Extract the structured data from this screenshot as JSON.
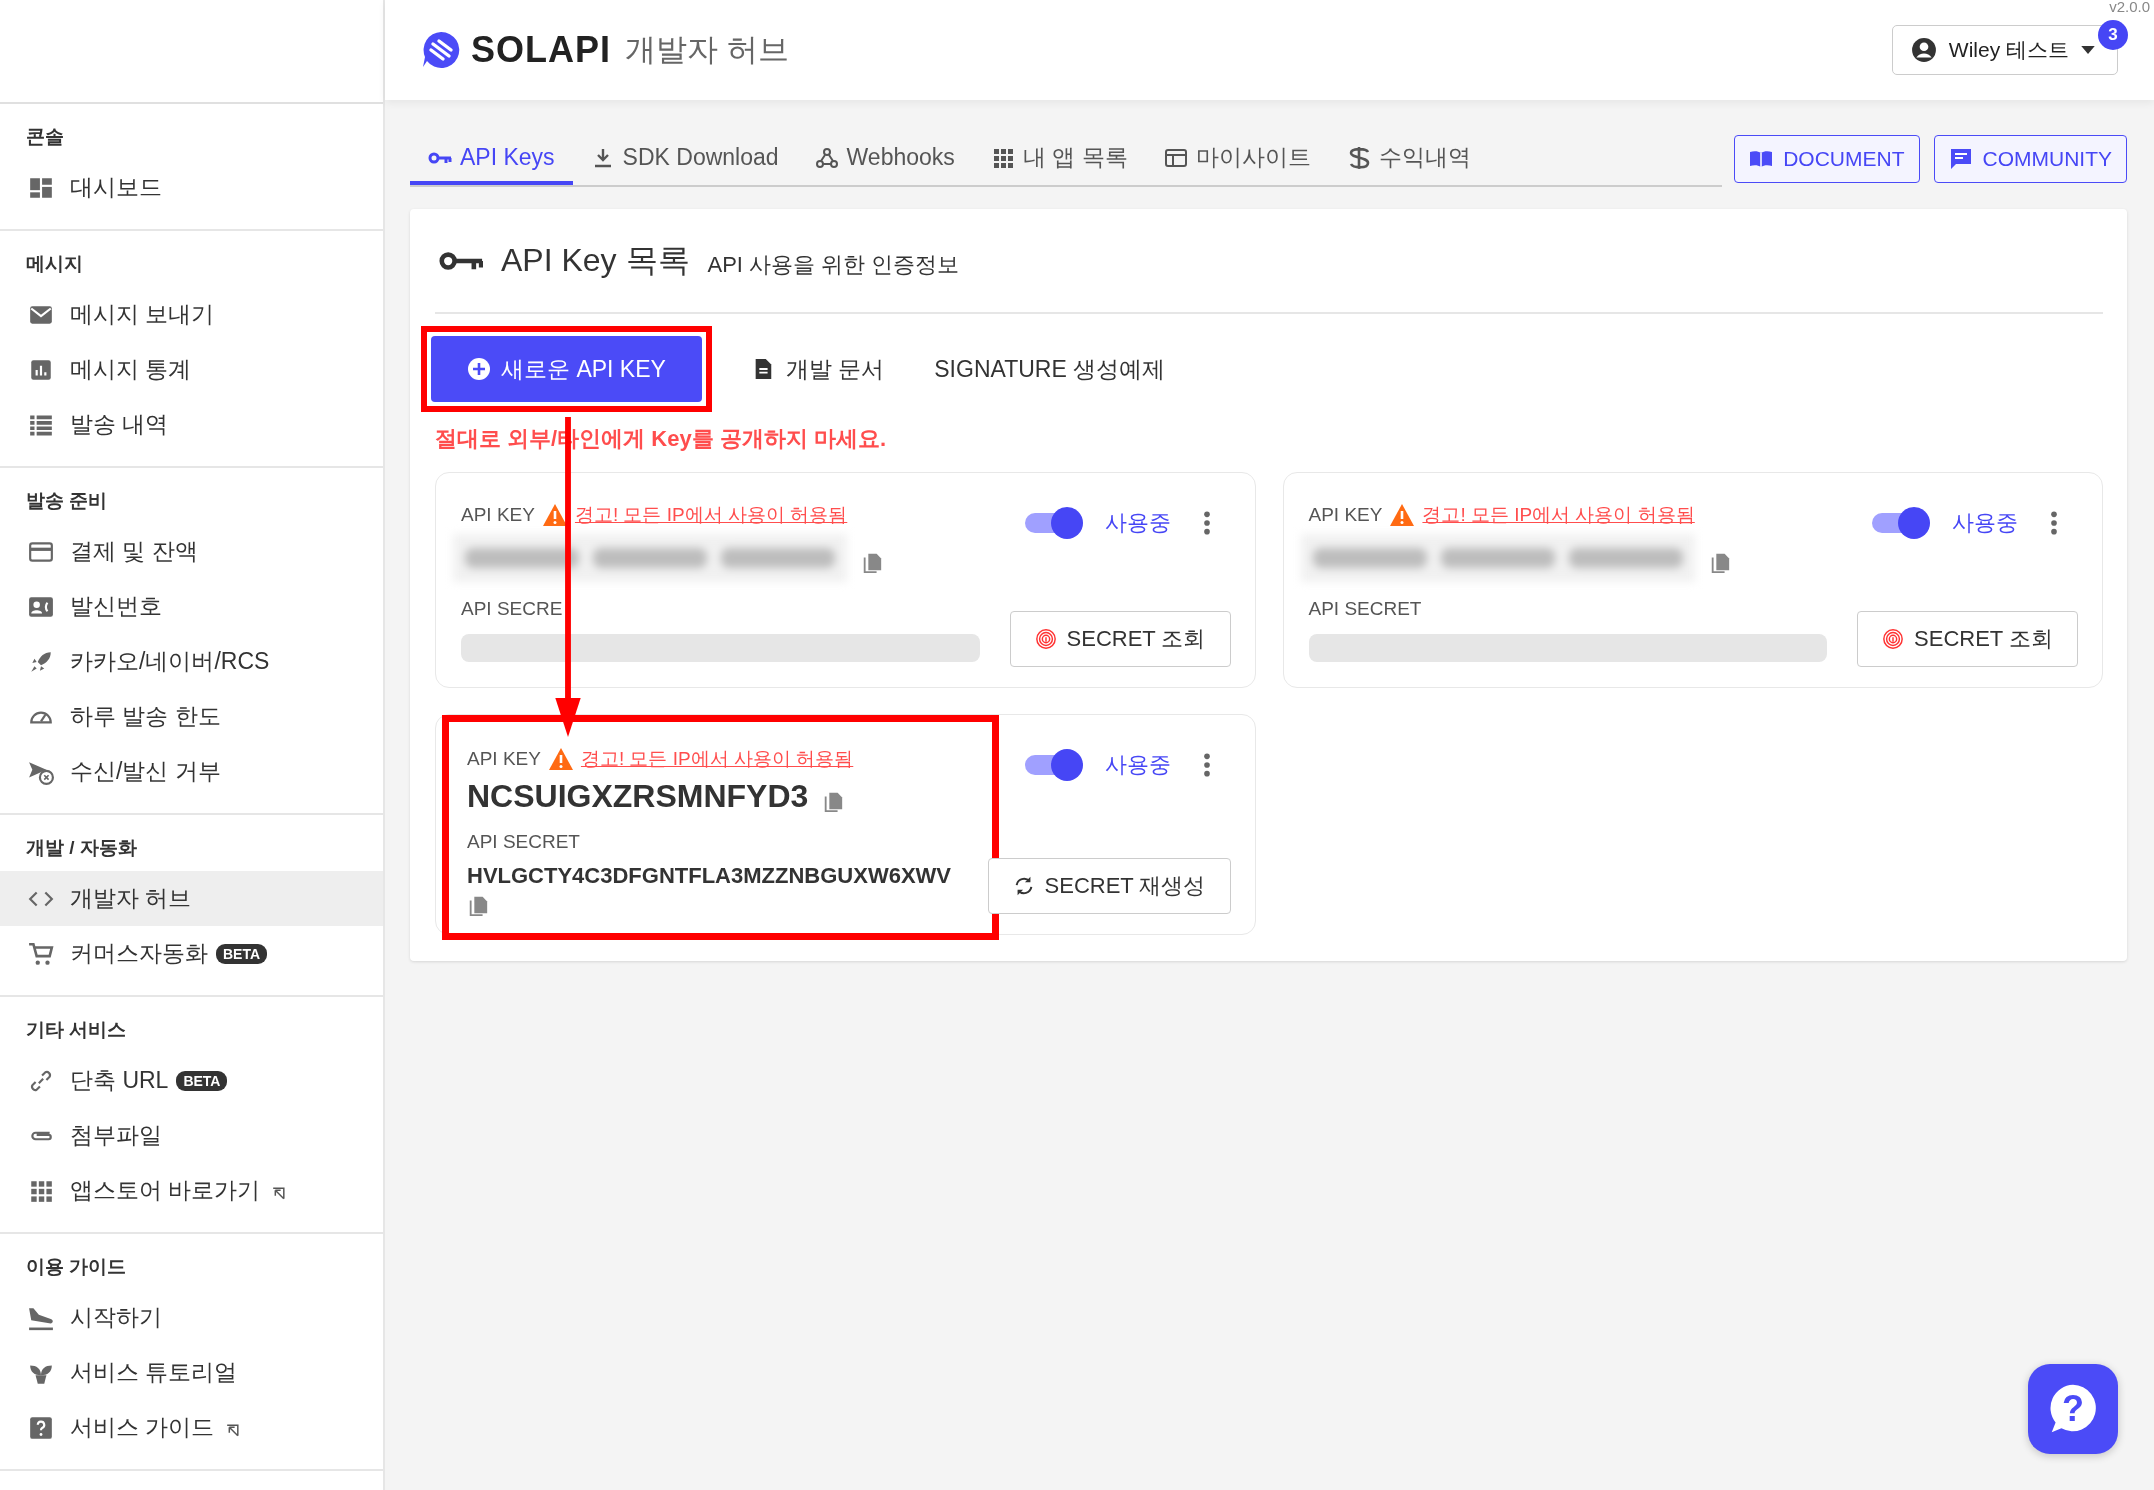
{
  "header": {
    "logo": "SOLAPI",
    "subtitle": "개발자 허브",
    "version": "v2.0.0",
    "user": "Wiley 테스트",
    "notification_count": "3"
  },
  "sidebar": {
    "sections": [
      {
        "title": "콘솔",
        "items": [
          {
            "label": "대시보드",
            "selected": false
          }
        ]
      },
      {
        "title": "메시지",
        "items": [
          {
            "label": "메시지 보내기",
            "selected": false
          },
          {
            "label": "메시지 통계",
            "selected": false
          },
          {
            "label": "발송 내역",
            "selected": false
          }
        ]
      },
      {
        "title": "발송 준비",
        "items": [
          {
            "label": "결제 및 잔액",
            "selected": false
          },
          {
            "label": "발신번호",
            "selected": false
          },
          {
            "label": "카카오/네이버/RCS",
            "selected": false
          },
          {
            "label": "하루 발송 한도",
            "selected": false
          },
          {
            "label": "수신/발신 거부",
            "selected": false
          }
        ]
      },
      {
        "title": "개발 / 자동화",
        "items": [
          {
            "label": "개발자 허브",
            "selected": true
          },
          {
            "label": "커머스자동화",
            "badge": "BETA",
            "selected": false
          }
        ]
      },
      {
        "title": "기타 서비스",
        "items": [
          {
            "label": "단축 URL",
            "badge": "BETA",
            "selected": false
          },
          {
            "label": "첨부파일",
            "selected": false
          },
          {
            "label": "앱스토어 바로가기",
            "external": true,
            "selected": false
          }
        ]
      },
      {
        "title": "이용 가이드",
        "items": [
          {
            "label": "시작하기",
            "selected": false
          },
          {
            "label": "서비스 튜토리얼",
            "selected": false
          },
          {
            "label": "서비스 가이드",
            "external": true,
            "selected": false
          }
        ]
      }
    ]
  },
  "tabs": [
    {
      "label": "API Keys",
      "selected": true
    },
    {
      "label": "SDK Download",
      "selected": false
    },
    {
      "label": "Webhooks",
      "selected": false
    },
    {
      "label": "내 앱 목록",
      "selected": false
    },
    {
      "label": "마이사이트",
      "selected": false
    },
    {
      "label": "수익내역",
      "selected": false
    }
  ],
  "links": [
    "DOCUMENT",
    "COMMUNITY"
  ],
  "panel": {
    "title": "API Key 목록",
    "subtitle": "API 사용을 위한 인증정보",
    "new_button": {
      "label": "새로운 API KEY",
      "highlighted": true
    },
    "actions": [
      "개발 문서",
      "SIGNATURE 생성예제"
    ],
    "warning": "절대로 외부/타인에게 Key를 공개하지 마세요."
  },
  "keys": [
    {
      "kind": "masked",
      "key_label": "API KEY",
      "ip_warning": "경고! 모든 IP에서 사용이 허용됨",
      "secret_label": "API SECRE",
      "on": true,
      "status": "사용중",
      "button": "SECRET 조회",
      "highlighted": false
    },
    {
      "kind": "masked",
      "key_label": "API KEY",
      "ip_warning": "경고! 모든 IP에서 사용이 허용됨",
      "secret_label": "API SECRET",
      "on": true,
      "status": "사용중",
      "button": "SECRET 조회",
      "highlighted": false
    },
    {
      "kind": "revealed",
      "key_label": "API KEY",
      "ip_warning": "경고! 모든 IP에서 사용이 허용됨",
      "key": "NCSUIGXZRSMNFYD3",
      "secret_label": "API SECRET",
      "secret": "HVLGCTY4C3DFGNTFLA3MZZNBGUXW6XWV",
      "on": true,
      "status": "사용중",
      "button": "SECRET 재생성",
      "highlighted": true
    }
  ],
  "help_button": {
    "label": "?"
  }
}
